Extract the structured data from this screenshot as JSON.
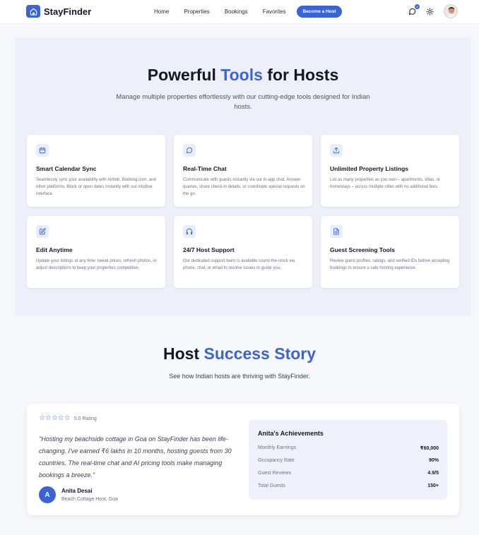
{
  "nav": {
    "brand": "StayFinder",
    "links": [
      "Home",
      "Properties",
      "Bookings",
      "Favorites"
    ],
    "cta": "Become a Host",
    "notification_count": "3",
    "icons": [
      "home-icon",
      "chat-icon",
      "sun-icon"
    ]
  },
  "tools": {
    "title_prefix": "Powerful",
    "title_accent": "Tools",
    "title_suffix": "for Hosts",
    "subtitle": "Manage multiple properties effortlessly with our cutting-edge tools designed for Indian hosts.",
    "cards": [
      {
        "icon": "calendar-icon",
        "title": "Smart Calendar Sync",
        "desc": "Seamlessly sync your availability with Airbnb, Booking.com, and other platforms. Block or open dates instantly with our intuitive interface."
      },
      {
        "icon": "chat-icon",
        "title": "Real-Time Chat",
        "desc": "Communicate with guests instantly via our in-app chat. Answer queries, share check-in details, or coordinate special requests on the go."
      },
      {
        "icon": "upload-icon",
        "title": "Unlimited Property Listings",
        "desc": "List as many properties as you own – apartments, villas, or homestays – across multiple cities with no additional fees."
      },
      {
        "icon": "edit-icon",
        "title": "Edit Anytime",
        "desc": "Update your listings at any time: tweak prices, refresh photos, or adjust descriptions to keep your properties competitive."
      },
      {
        "icon": "headphones-icon",
        "title": "24/7 Host Support",
        "desc": "Our dedicated support team is available round-the-clock via phone, chat, or email to resolve issues or guide you."
      },
      {
        "icon": "document-icon",
        "title": "Guest Screening Tools",
        "desc": "Review guest profiles, ratings, and verified IDs before accepting bookings to ensure a safe hosting experience."
      }
    ]
  },
  "story": {
    "title_prefix": "Host",
    "title_accent": "Success Story",
    "subtitle": "See how Indian hosts are thriving with StayFinder.",
    "rating_label": "5.0 Rating",
    "rating_value": 5,
    "quote": "\"Hosting my beachside cottage in Goa on StayFinder has been life-changing. I've earned ₹6 lakhs in 10 months, hosting guests from 30 countries. The real-time chat and AI pricing tools make managing bookings a breeze.\"",
    "author_initial": "A",
    "author_name": "Anita Desai",
    "author_role": "Beach Cottage Host, Goa",
    "achievements": {
      "title": "Anita's Achievements",
      "rows": [
        {
          "label": "Monthly Earnings",
          "value": "₹60,000"
        },
        {
          "label": "Occupancy Rate",
          "value": "90%"
        },
        {
          "label": "Guest Reviews",
          "value": "4.9/5"
        },
        {
          "label": "Total Guests",
          "value": "150+"
        }
      ]
    }
  },
  "colors": {
    "accent": "#3b63d8",
    "section_bg": "#eef0f9"
  }
}
